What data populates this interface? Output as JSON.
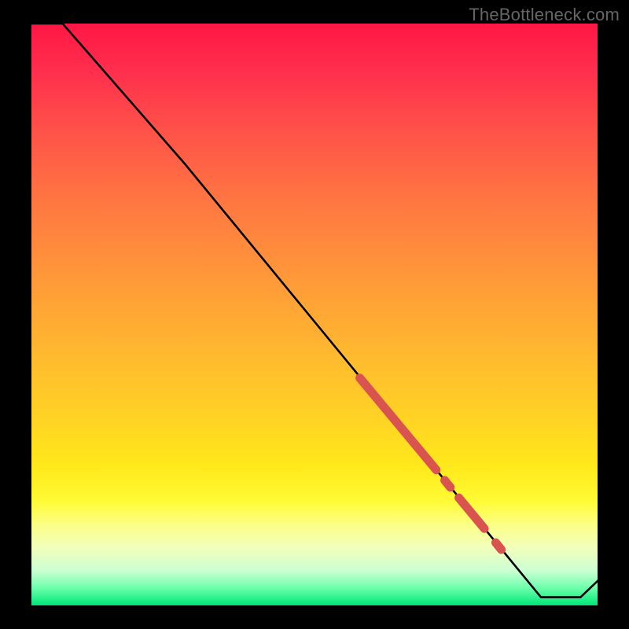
{
  "watermark": "TheBottleneck.com",
  "chart_data": {
    "type": "line",
    "title": "",
    "xlabel": "",
    "ylabel": "",
    "xlim": [
      0,
      100
    ],
    "ylim": [
      0,
      100
    ],
    "x": [
      0,
      5.5,
      27,
      90,
      97,
      100
    ],
    "y": [
      100,
      100,
      76,
      1.4,
      1.4,
      4.2
    ],
    "highlights": [
      {
        "x1": 58,
        "y1": 39.1,
        "x2": 71.5,
        "y2": 23.3
      },
      {
        "x1": 73,
        "y1": 21.5,
        "x2": 74,
        "y2": 20.3
      },
      {
        "x1": 75.5,
        "y1": 18.5,
        "x2": 80,
        "y2": 13.2
      },
      {
        "x1": 82,
        "y1": 10.8,
        "x2": 83,
        "y2": 9.6
      }
    ],
    "highlight_color": "#d9534f",
    "line_color": "#000000",
    "gradient_stops": [
      {
        "pos": 0,
        "color": "#ff1744"
      },
      {
        "pos": 18,
        "color": "#ff5049"
      },
      {
        "pos": 48,
        "color": "#ffa336"
      },
      {
        "pos": 76,
        "color": "#ffe81b"
      },
      {
        "pos": 90,
        "color": "#f2ffbb"
      },
      {
        "pos": 100,
        "color": "#00e676"
      }
    ]
  }
}
